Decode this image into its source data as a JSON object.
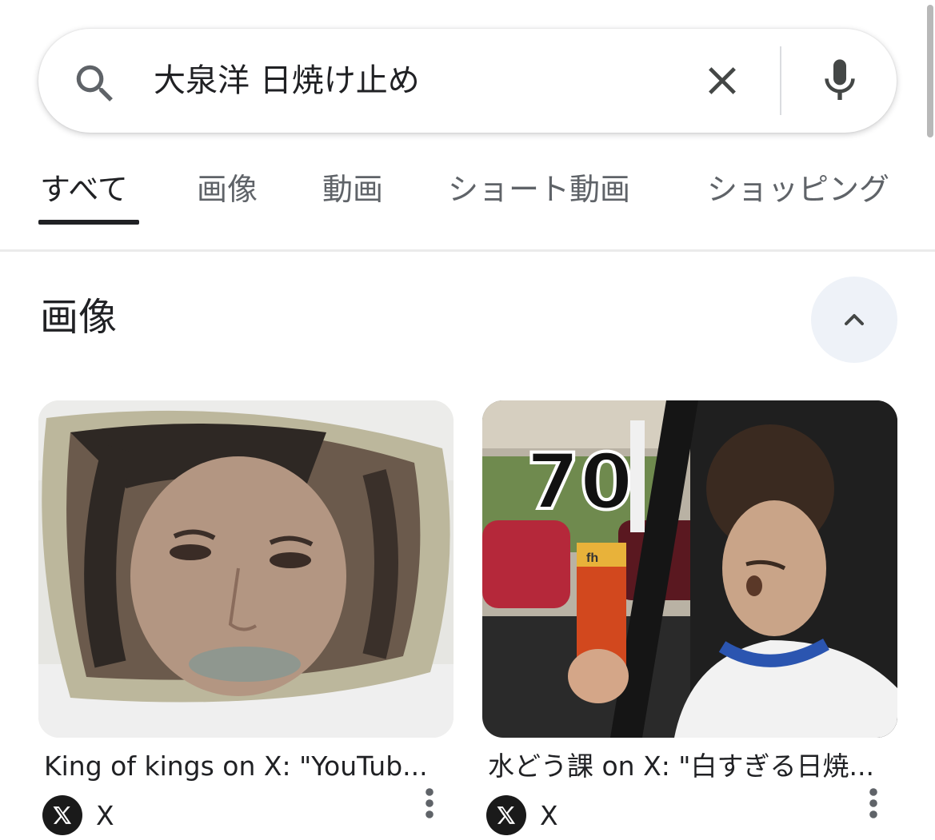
{
  "search": {
    "query": "大泉洋 日焼け止め",
    "icons": {
      "search": "search-icon",
      "clear": "close-icon",
      "voice": "mic-icon"
    }
  },
  "tabs": [
    {
      "label": "すべて",
      "active": true
    },
    {
      "label": "画像",
      "active": false
    },
    {
      "label": "動画",
      "active": false
    },
    {
      "label": "ショート動画",
      "active": false
    },
    {
      "label": "ショッピング",
      "active": false
    }
  ],
  "images_section": {
    "title": "画像",
    "collapse_icon": "chevron-up-icon",
    "results": [
      {
        "title": "King of kings on X: \"YouTub...",
        "source": "X",
        "menu_icon": "more-vert-icon"
      },
      {
        "title": "水どう課 on X: \"白すぎる日焼...",
        "source": "X",
        "menu_icon": "more-vert-icon",
        "overlay_text": "70"
      }
    ]
  },
  "colors": {
    "text_primary": "#202124",
    "text_secondary": "#5f6368",
    "collapse_bg": "#eef2f8",
    "divider": "#ebebeb"
  }
}
